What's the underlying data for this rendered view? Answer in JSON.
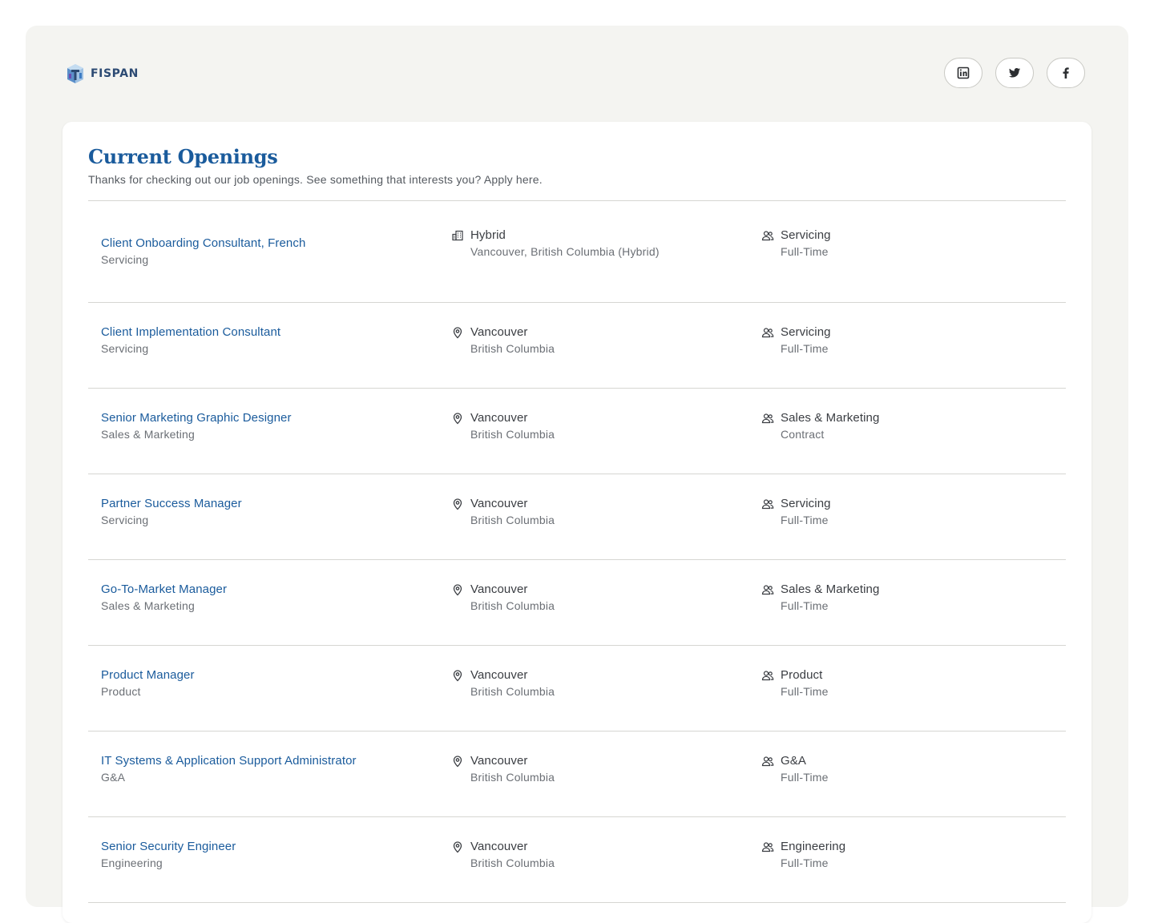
{
  "brand": {
    "logo_text": "FISPAN"
  },
  "social": [
    {
      "name": "linkedin-icon"
    },
    {
      "name": "twitter-icon"
    },
    {
      "name": "facebook-icon"
    }
  ],
  "section": {
    "title": "Current Openings",
    "subtitle": "Thanks for checking out our job openings. See something that interests you? Apply here."
  },
  "jobs": [
    {
      "title": "Client Onboarding Consultant, French",
      "team": "Servicing",
      "location_icon": "building-icon",
      "location_primary": "Hybrid",
      "location_secondary": "Vancouver, British Columbia (Hybrid)",
      "department": "Servicing",
      "employment_type": "Full-Time"
    },
    {
      "title": "Client Implementation Consultant",
      "team": "Servicing",
      "location_icon": "location-pin-icon",
      "location_primary": "Vancouver",
      "location_secondary": "British Columbia",
      "department": "Servicing",
      "employment_type": "Full-Time"
    },
    {
      "title": "Senior Marketing Graphic Designer",
      "team": "Sales & Marketing",
      "location_icon": "location-pin-icon",
      "location_primary": "Vancouver",
      "location_secondary": "British Columbia",
      "department": "Sales & Marketing",
      "employment_type": "Contract"
    },
    {
      "title": "Partner Success Manager",
      "team": "Servicing",
      "location_icon": "location-pin-icon",
      "location_primary": "Vancouver",
      "location_secondary": "British Columbia",
      "department": "Servicing",
      "employment_type": "Full-Time"
    },
    {
      "title": "Go-To-Market Manager",
      "team": "Sales & Marketing",
      "location_icon": "location-pin-icon",
      "location_primary": "Vancouver",
      "location_secondary": "British Columbia",
      "department": "Sales & Marketing",
      "employment_type": "Full-Time"
    },
    {
      "title": "Product Manager",
      "team": "Product",
      "location_icon": "location-pin-icon",
      "location_primary": "Vancouver",
      "location_secondary": "British Columbia",
      "department": "Product",
      "employment_type": "Full-Time"
    },
    {
      "title": "IT Systems & Application Support Administrator",
      "team": "G&A",
      "location_icon": "location-pin-icon",
      "location_primary": "Vancouver",
      "location_secondary": "British Columbia",
      "department": "G&A",
      "employment_type": "Full-Time"
    },
    {
      "title": "Senior Security Engineer",
      "team": "Engineering",
      "location_icon": "location-pin-icon",
      "location_primary": "Vancouver",
      "location_secondary": "British Columbia",
      "department": "Engineering",
      "employment_type": "Full-Time"
    }
  ]
}
